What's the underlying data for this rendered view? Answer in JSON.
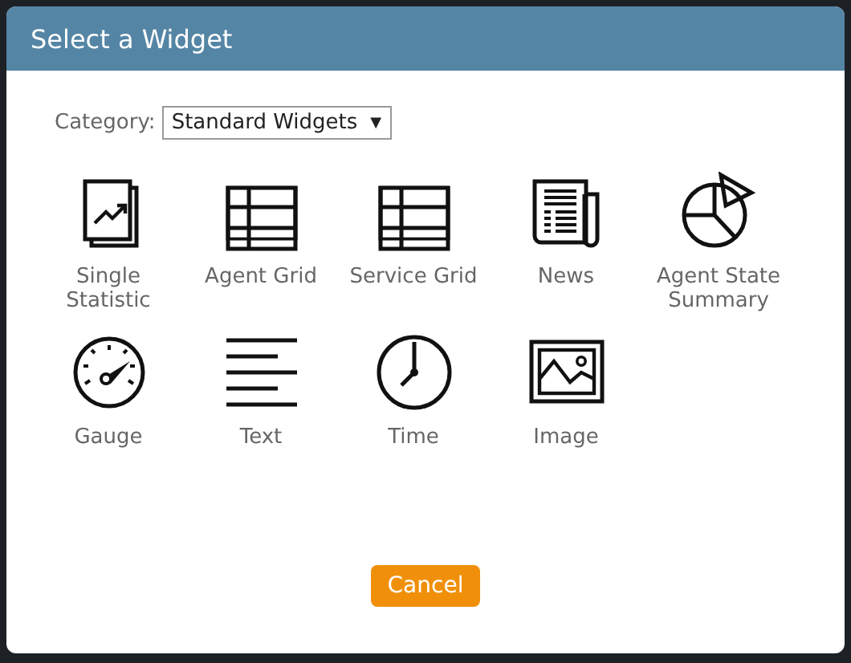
{
  "dialog": {
    "title": "Select a Widget"
  },
  "category": {
    "label": "Category:",
    "value": "Standard Widgets",
    "arrow": "▼"
  },
  "widgets": [
    {
      "kind": "statistic",
      "label": "Single Statistic"
    },
    {
      "kind": "grid",
      "label": "Agent Grid"
    },
    {
      "kind": "grid",
      "label": "Service Grid"
    },
    {
      "kind": "news",
      "label": "News"
    },
    {
      "kind": "pie",
      "label": "Agent State Summary"
    },
    {
      "kind": "gauge",
      "label": "Gauge"
    },
    {
      "kind": "text",
      "label": "Text"
    },
    {
      "kind": "clock",
      "label": "Time"
    },
    {
      "kind": "image",
      "label": "Image"
    }
  ],
  "buttons": [
    "Cancel"
  ]
}
